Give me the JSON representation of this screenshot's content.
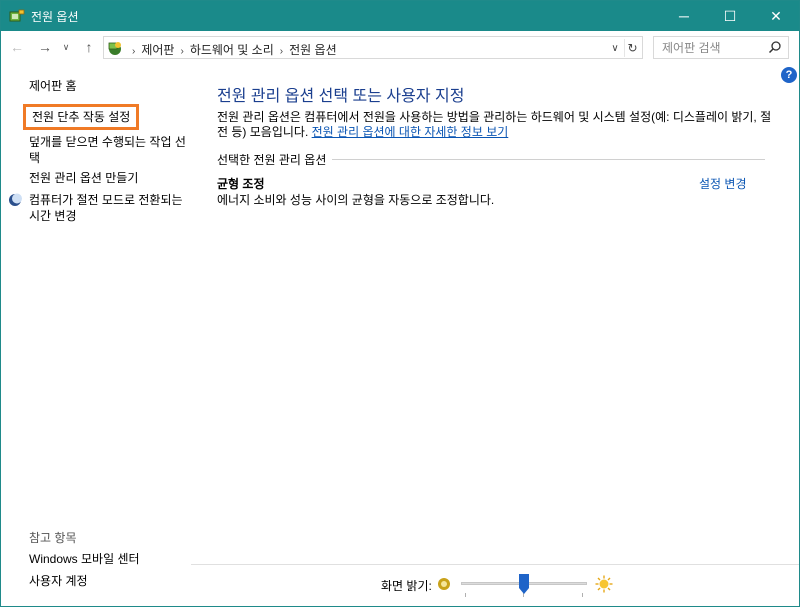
{
  "window": {
    "title": "전원 옵션",
    "controls": {
      "minimize": "─",
      "maximize": "☐",
      "close": "✕"
    },
    "accent_color": "#1a8a8a"
  },
  "navigation": {
    "back": "←",
    "forward": "→",
    "recent": "∨",
    "up": "↑",
    "breadcrumbs": [
      "제어판",
      "하드웨어 및 소리",
      "전원 옵션"
    ],
    "separator": "›",
    "dropdown": "∨",
    "refresh": "↻",
    "search_placeholder": "제어판 검색"
  },
  "help": {
    "label": "?"
  },
  "sidebar": {
    "home": "제어판 홈",
    "items": [
      {
        "label": "전원 단추 작동 설정",
        "selected": true
      },
      {
        "label": "덮개를 닫으면 수행되는 작업 선택"
      },
      {
        "label": "전원 관리 옵션 만들기"
      },
      {
        "label": "컴퓨터가 절전 모드로 전환되는 시간 변경"
      }
    ],
    "see_also_title": "참고 항목",
    "see_also": [
      "Windows 모바일 센터",
      "사용자 계정"
    ],
    "highlight_color": "#f07a26"
  },
  "main": {
    "title": "전원 관리 옵션 선택 또는 사용자 지정",
    "description": "전원 관리 옵션은 컴퓨터에서 전원을 사용하는 방법을 관리하는 하드웨어 및 시스템 설정(예: 디스플레이 밝기, 절전 등) 모음입니다.",
    "description_link": "전원 관리 옵션에 대한 자세한 정보 보기",
    "section_label": "선택한 전원 관리 옵션",
    "plan": {
      "name": "균형 조정",
      "description": "에너지 소비와 성능 사이의 균형을 자동으로 조정합니다.",
      "change_link": "설정 변경"
    },
    "link_color": "#0a55b3",
    "title_color": "#1b3f8f"
  },
  "brightness": {
    "label": "화면 밝기:",
    "level": 0.5,
    "thumb_color": "#1f64c8"
  }
}
